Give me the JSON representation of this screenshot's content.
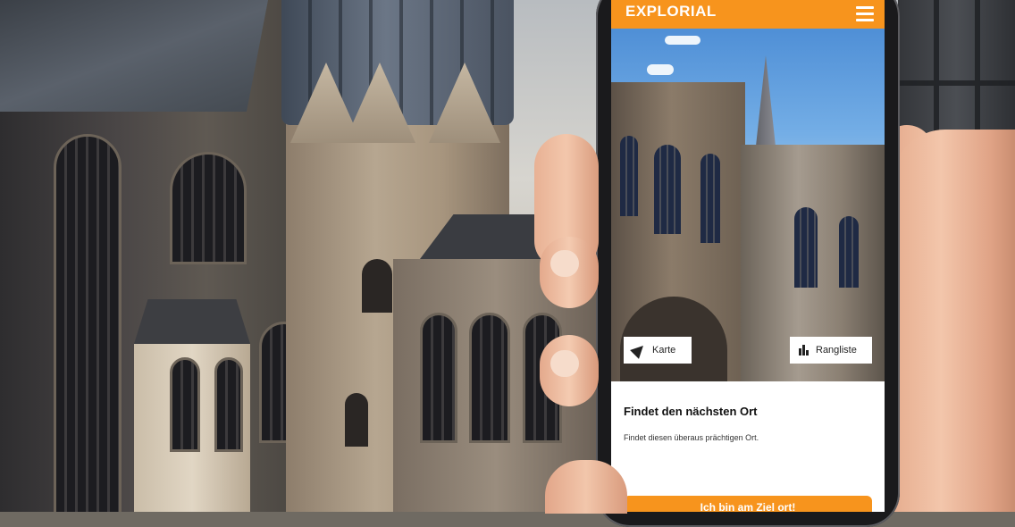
{
  "app": {
    "logo": "EXPLORIAL",
    "menu_icon": "hamburger-menu-icon"
  },
  "actions": {
    "map_label": "Karte",
    "map_icon": "navigation-arrow-icon",
    "ranking_label": "Rangliste",
    "ranking_icon": "podium-icon"
  },
  "card": {
    "title": "Findet den nächsten Ort",
    "description": "Findet diesen überaus prächtigen Ort.",
    "button_label": "Ich bin am Ziel ort!"
  },
  "colors": {
    "brand_orange": "#f7941d",
    "card_bg": "#ffffff",
    "text_dark": "#111111"
  }
}
